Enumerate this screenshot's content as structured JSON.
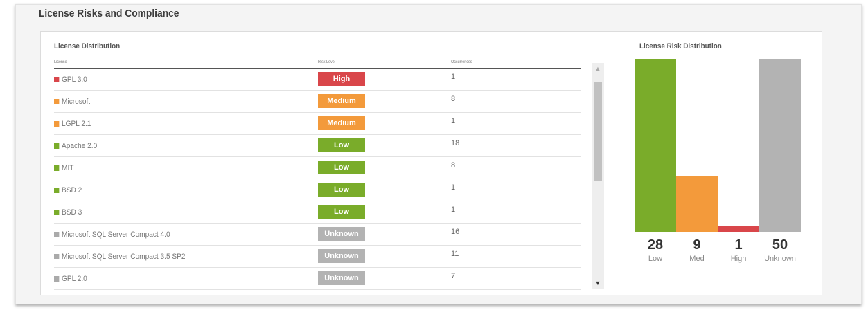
{
  "section": {
    "title": "License Risks and Compliance"
  },
  "distribution": {
    "title": "License Distribution",
    "columns": {
      "license": "License",
      "risk": "Risk Level",
      "occ": "Occurrences"
    },
    "rows": [
      {
        "license": "GPL 3.0",
        "risk": "High",
        "occurrences": "1",
        "color": "#d9464a"
      },
      {
        "license": "Microsoft",
        "risk": "Medium",
        "occurrences": "8",
        "color": "#f39a3b"
      },
      {
        "license": "LGPL 2.1",
        "risk": "Medium",
        "occurrences": "1",
        "color": "#f39a3b"
      },
      {
        "license": "Apache 2.0",
        "risk": "Low",
        "occurrences": "18",
        "color": "#7aac2a"
      },
      {
        "license": "MIT",
        "risk": "Low",
        "occurrences": "8",
        "color": "#7aac2a"
      },
      {
        "license": "BSD 2",
        "risk": "Low",
        "occurrences": "1",
        "color": "#7aac2a"
      },
      {
        "license": "BSD 3",
        "risk": "Low",
        "occurrences": "1",
        "color": "#7aac2a"
      },
      {
        "license": "Microsoft SQL Server Compact 4.0",
        "risk": "Unknown",
        "occurrences": "16",
        "color": "#aaaaaa"
      },
      {
        "license": "Microsoft SQL Server Compact 3.5 SP2",
        "risk": "Unknown",
        "occurrences": "11",
        "color": "#aaaaaa"
      },
      {
        "license": "GPL 2.0",
        "risk": "Unknown",
        "occurrences": "7",
        "color": "#aaaaaa"
      }
    ]
  },
  "risk_distribution": {
    "title": "License Risk Distribution",
    "bars": [
      {
        "value": "28",
        "label": "Low",
        "level": 1.0,
        "color": "#7aac2a"
      },
      {
        "value": "9",
        "label": "Med",
        "level": 0.32,
        "color": "#f39a3b"
      },
      {
        "value": "1",
        "label": "High",
        "level": 0.036,
        "color": "#d9464a"
      },
      {
        "value": "50",
        "label": "Unknown",
        "level": 1.0,
        "color": "#b3b3b3"
      }
    ]
  }
}
